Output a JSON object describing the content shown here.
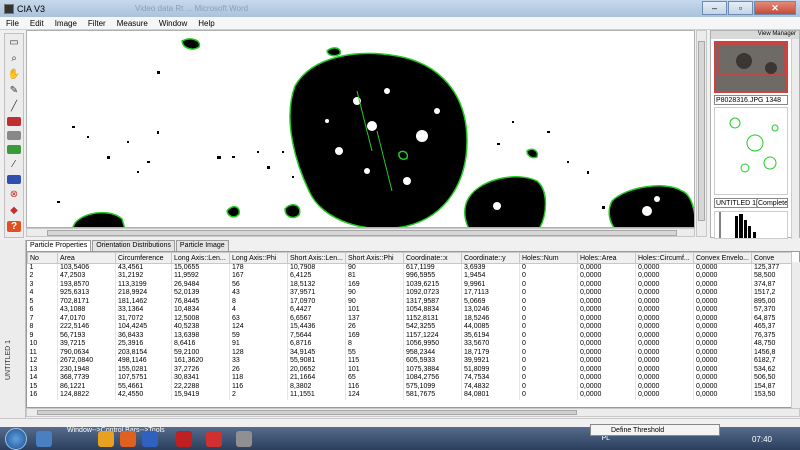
{
  "window": {
    "title": "CIA V3",
    "ghost_title": "Video data Rt ... Microsoft Word"
  },
  "menu": [
    "File",
    "Edit",
    "Image",
    "Filter",
    "Measure",
    "Window",
    "Help"
  ],
  "view_manager": {
    "title": "View Manager",
    "items": [
      {
        "label": "P8028316.JPG  1348"
      },
      {
        "label": "UNTITLED 1[Complete]"
      }
    ]
  },
  "left_strip_label": "UNTITLED 1",
  "tabs": [
    "Particle Properties",
    "Orientation Distributions",
    "Particle Image"
  ],
  "table": {
    "columns": [
      "No",
      "Area",
      "Circumference",
      "Long Axis::Len...",
      "Long Axis::Phi",
      "Short Axis::Len...",
      "Short Axis::Phi",
      "Coordinate::x",
      "Coordinate::y",
      "Holes::Num",
      "Holes::Area",
      "Holes::Circumf...",
      "Convex Envelo...",
      "Conve"
    ],
    "rows": [
      [
        "1",
        "103,5406",
        "43,4561",
        "15,0655",
        "178",
        "10,7908",
        "90",
        "617,1199",
        "3,6939",
        "0",
        "0,0000",
        "0,0000",
        "0,0000",
        "125,377"
      ],
      [
        "2",
        "47,2503",
        "31,2192",
        "11,9592",
        "167",
        "6,4125",
        "81",
        "996,5955",
        "1,9454",
        "0",
        "0,0000",
        "0,0000",
        "0,0000",
        "58,500"
      ],
      [
        "3",
        "193,8570",
        "113,3199",
        "26,9484",
        "56",
        "18,5132",
        "169",
        "1039,6215",
        "9,9961",
        "0",
        "0,0000",
        "0,0000",
        "0,0000",
        "374,87"
      ],
      [
        "4",
        "925,6313",
        "218,9924",
        "52,0139",
        "43",
        "37,9571",
        "90",
        "1092,0723",
        "17,7113",
        "0",
        "0,0000",
        "0,0000",
        "0,0000",
        "1517,2"
      ],
      [
        "5",
        "702,8171",
        "181,1462",
        "76,8445",
        "8",
        "17,0970",
        "90",
        "1317,9587",
        "5,0669",
        "0",
        "0,0000",
        "0,0000",
        "0,0000",
        "895,00"
      ],
      [
        "6",
        "43,1088",
        "33,1364",
        "10,4834",
        "4",
        "6,4427",
        "101",
        "1054,8834",
        "13,0246",
        "0",
        "0,0000",
        "0,0000",
        "0,0000",
        "57,370"
      ],
      [
        "7",
        "47,0170",
        "31,7072",
        "12,5008",
        "63",
        "6,6567",
        "137",
        "1152,8131",
        "18,5246",
        "0",
        "0,0000",
        "0,0000",
        "0,0000",
        "64,875"
      ],
      [
        "8",
        "222,5146",
        "104,4245",
        "40,5238",
        "124",
        "15,4436",
        "26",
        "542,3255",
        "44,0085",
        "0",
        "0,0000",
        "0,0000",
        "0,0000",
        "465,37"
      ],
      [
        "9",
        "56,7193",
        "36,8433",
        "13,6398",
        "59",
        "7,5644",
        "169",
        "1157,1224",
        "35,6194",
        "0",
        "0,0000",
        "0,0000",
        "0,0000",
        "76,375"
      ],
      [
        "10",
        "39,7215",
        "25,3916",
        "8,6416",
        "91",
        "6,8716",
        "8",
        "1056,9950",
        "33,5670",
        "0",
        "0,0000",
        "0,0000",
        "0,0000",
        "48,750"
      ],
      [
        "11",
        "790,0634",
        "203,8154",
        "59,2100",
        "128",
        "34,9145",
        "55",
        "958,2344",
        "18,7179",
        "0",
        "0,0000",
        "0,0000",
        "0,0000",
        "1456,8"
      ],
      [
        "12",
        "2672,0840",
        "498,1146",
        "161,3620",
        "33",
        "55,9081",
        "115",
        "605,5933",
        "39,9921",
        "0",
        "0,0000",
        "0,0000",
        "0,0000",
        "6182,7"
      ],
      [
        "13",
        "230,1948",
        "155,0281",
        "37,2726",
        "26",
        "20,0652",
        "101",
        "1075,3884",
        "51,8099",
        "0",
        "0,0000",
        "0,0000",
        "0,0000",
        "534,62"
      ],
      [
        "14",
        "368,7739",
        "107,5751",
        "30,8341",
        "118",
        "21,1664",
        "65",
        "1084,2756",
        "74,7534",
        "0",
        "0,0000",
        "0,0000",
        "0,0000",
        "506,50"
      ],
      [
        "15",
        "86,1221",
        "55,4661",
        "22,2288",
        "116",
        "8,3802",
        "116",
        "575,1099",
        "74,4832",
        "0",
        "0,0000",
        "0,0000",
        "0,0000",
        "154,87"
      ],
      [
        "16",
        "124,8822",
        "42,4550",
        "15,9419",
        "2",
        "11,1551",
        "124",
        "581,7675",
        "84,0801",
        "0",
        "0,0000",
        "0,0000",
        "0,0000",
        "153,50"
      ]
    ]
  },
  "taskbar": {
    "tooltip": "Window-->Control Bars-->Tools",
    "popup": "Define Threshold",
    "lang": "PL",
    "time": "07:40"
  },
  "colors": {
    "particle": "#000000",
    "outline": "#22cc22",
    "background": "#ffffff"
  }
}
